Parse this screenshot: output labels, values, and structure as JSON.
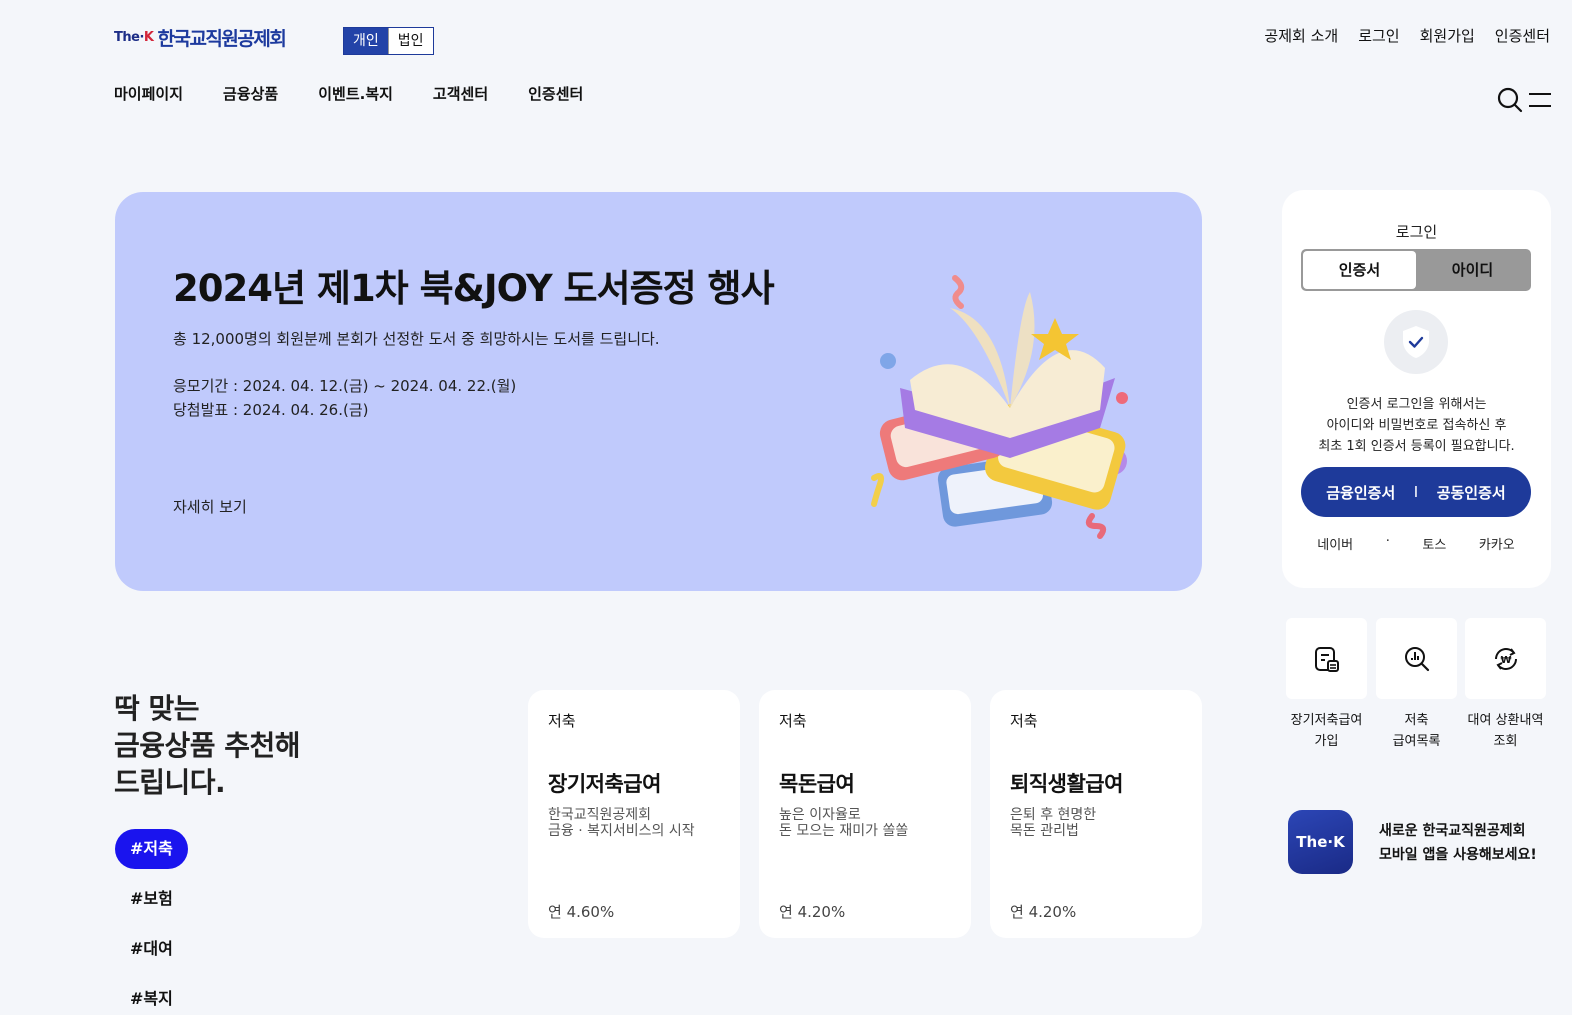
{
  "header": {
    "logo_mark": "The",
    "logo_mark_k": "K",
    "logo_text": "한국교직원공제회",
    "segment": [
      "개인",
      "법인"
    ],
    "util": [
      "공제회 소개",
      "로그인",
      "회원가입",
      "인증센터"
    ],
    "gnb": [
      "마이페이지",
      "금융상품",
      "이벤트.복지",
      "고객센터",
      "인증센터"
    ]
  },
  "banner": {
    "title": "2024년 제1차 북&JOY 도서증정 행사",
    "subtitle": "총 12,000명의 회원분께 본회가 선정한 도서 중 희망하시는 도서를 드립니다.",
    "period": "응모기간 : 2024. 04. 12.(금) ~ 2024. 04. 22.(월)",
    "announce": "당첨발표 : 2024. 04. 26.(금)",
    "more": "자세히 보기"
  },
  "login": {
    "title": "로그인",
    "tabs": [
      "인증서",
      "아이디"
    ],
    "desc": [
      "인증서 로그인을 위해서는",
      "아이디와 비밀번호로 접속하신 후",
      "최초 1회 인증서 등록이 필요합니다."
    ],
    "cert_financial": "금융인증서",
    "cert_divider": "I",
    "cert_public": "공동인증서",
    "social": [
      "네이버",
      "·",
      "토스",
      "카카오"
    ]
  },
  "quick": [
    {
      "label": "장기저축급여\n가입",
      "icon": "document-coin-icon"
    },
    {
      "label": "저축\n급여목록",
      "icon": "search-coin-icon"
    },
    {
      "label": "대여 상환내역\n조회",
      "icon": "refresh-won-icon"
    }
  ],
  "app": {
    "icon_text": "The",
    "icon_k": "K",
    "line1": "새로운 한국교직원공제회",
    "line2": "모바일 앱을 사용해보세요!"
  },
  "recommend": {
    "title": [
      "딱 맞는",
      "금융상품 추천해",
      "드립니다."
    ],
    "tags": [
      "#저축",
      "#보험",
      "#대여",
      "#복지"
    ],
    "cards": [
      {
        "category": "저축",
        "name": "장기저축급여",
        "desc": "한국교직원공제회\n금융 · 복지서비스의 시작",
        "rate": "연 4.60%"
      },
      {
        "category": "저축",
        "name": "목돈급여",
        "desc": "높은 이자율로\n돈 모으는 재미가 쏠쏠",
        "rate": "연 4.20%"
      },
      {
        "category": "저축",
        "name": "퇴직생활급여",
        "desc": "은퇴 후 현명한\n목돈 관리법",
        "rate": "연 4.20%"
      }
    ]
  },
  "colors": {
    "brand": "#1e3a9a",
    "banner_bg": "#c0cafc",
    "tag_active": "#1a14ee",
    "page_bg": "#f4f6fa"
  }
}
